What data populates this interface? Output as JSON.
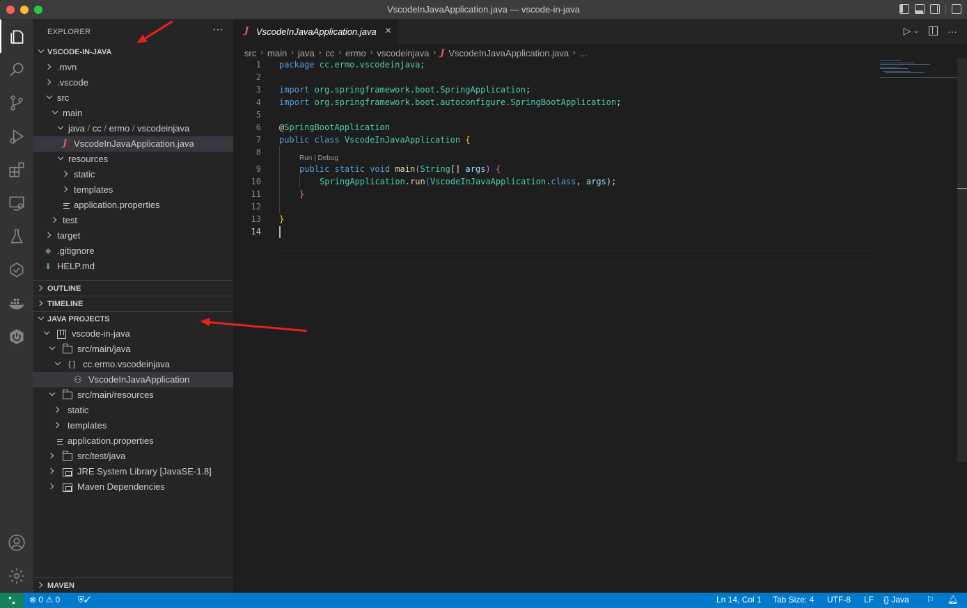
{
  "window": {
    "title": "VscodeInJavaApplication.java — vscode-in-java"
  },
  "activity": {
    "items": [
      "explorer-icon",
      "search-icon",
      "source-control-icon",
      "run-debug-icon",
      "extensions-icon",
      "remote-explorer-icon",
      "testing-icon",
      "gitlens-icon",
      "docker-icon",
      "spring-boot-icon"
    ],
    "bottom": [
      "account-icon",
      "settings-gear-icon"
    ]
  },
  "explorer": {
    "header": "EXPLORER",
    "more": "···",
    "workspace": "VSCODE-IN-JAVA",
    "files": [
      {
        "label": ".mvn"
      },
      {
        "label": ".vscode"
      },
      {
        "label": "src"
      },
      {
        "label": "main"
      },
      {
        "label": "java"
      },
      {
        "label": "cc"
      },
      {
        "label": "ermo"
      },
      {
        "label": "vscodeinjava"
      },
      {
        "label": "VscodeInJavaApplication.java"
      },
      {
        "label": "resources"
      },
      {
        "label": "static"
      },
      {
        "label": "templates"
      },
      {
        "label": "application.properties"
      },
      {
        "label": "test"
      },
      {
        "label": "target"
      },
      {
        "label": ".gitignore"
      },
      {
        "label": "HELP.md"
      }
    ],
    "path_sep": "/"
  },
  "sections": {
    "outline": "OUTLINE",
    "timeline": "TIMELINE",
    "java_projects": "JAVA PROJECTS",
    "maven": "MAVEN"
  },
  "java_projects": [
    {
      "label": "vscode-in-java"
    },
    {
      "label": "src/main/java"
    },
    {
      "label": "cc.ermo.vscodeinjava"
    },
    {
      "label": "VscodeInJavaApplication"
    },
    {
      "label": "src/main/resources"
    },
    {
      "label": "static"
    },
    {
      "label": "templates"
    },
    {
      "label": "application.properties"
    },
    {
      "label": "src/test/java"
    },
    {
      "label": "JRE System Library [JavaSE-1.8]"
    },
    {
      "label": "Maven Dependencies"
    }
  ],
  "package_icon": "{ }",
  "editor": {
    "tab_label": "VscodeInJavaApplication.java",
    "tab_icon": "J",
    "close": "×",
    "breadcrumb": [
      "src",
      "main",
      "java",
      "cc",
      "ermo",
      "vscodeinjava",
      "VscodeInJavaApplication.java",
      "..."
    ],
    "line_numbers": [
      "1",
      "2",
      "3",
      "4",
      "5",
      "6",
      "7",
      "8",
      "9",
      "10",
      "11",
      "12",
      "13",
      "14"
    ],
    "codelens": "Run | Debug"
  },
  "code": {
    "l1": [
      "package",
      " cc.ermo.vscodeinjava;"
    ],
    "l3": [
      "import",
      " org.springframework.boot.",
      "SpringApplication",
      ";"
    ],
    "l4": [
      "import",
      " org.springframework.boot.autoconfigure.",
      "SpringBootApplication",
      ";"
    ],
    "l6": [
      "@",
      "SpringBootApplication"
    ],
    "l7": [
      "public",
      " ",
      "class",
      " ",
      "VscodeInJavaApplication",
      " ",
      "{"
    ],
    "l9": [
      "public",
      " ",
      "static",
      " ",
      "void",
      " ",
      "main",
      "(",
      "String",
      "[] ",
      "args",
      ") ",
      "{"
    ],
    "l10": [
      "SpringApplication",
      ".",
      "run",
      "(",
      "VscodeInJavaApplication",
      ".",
      "class",
      ", ",
      "args",
      ");"
    ],
    "l11": [
      "}"
    ],
    "l13": [
      "}"
    ]
  },
  "statusbar": {
    "errors": "0",
    "warnings": "0",
    "position": "Ln 14, Col 1",
    "tab_size": "Tab Size: 4",
    "encoding": "UTF-8",
    "eol": "LF",
    "language_icon": "{}",
    "language": "Java"
  },
  "colors": {
    "statusbar": "#007acc",
    "remote": "#16825d",
    "arrow": "#e8221b",
    "java_icon": "#e05a5a"
  }
}
